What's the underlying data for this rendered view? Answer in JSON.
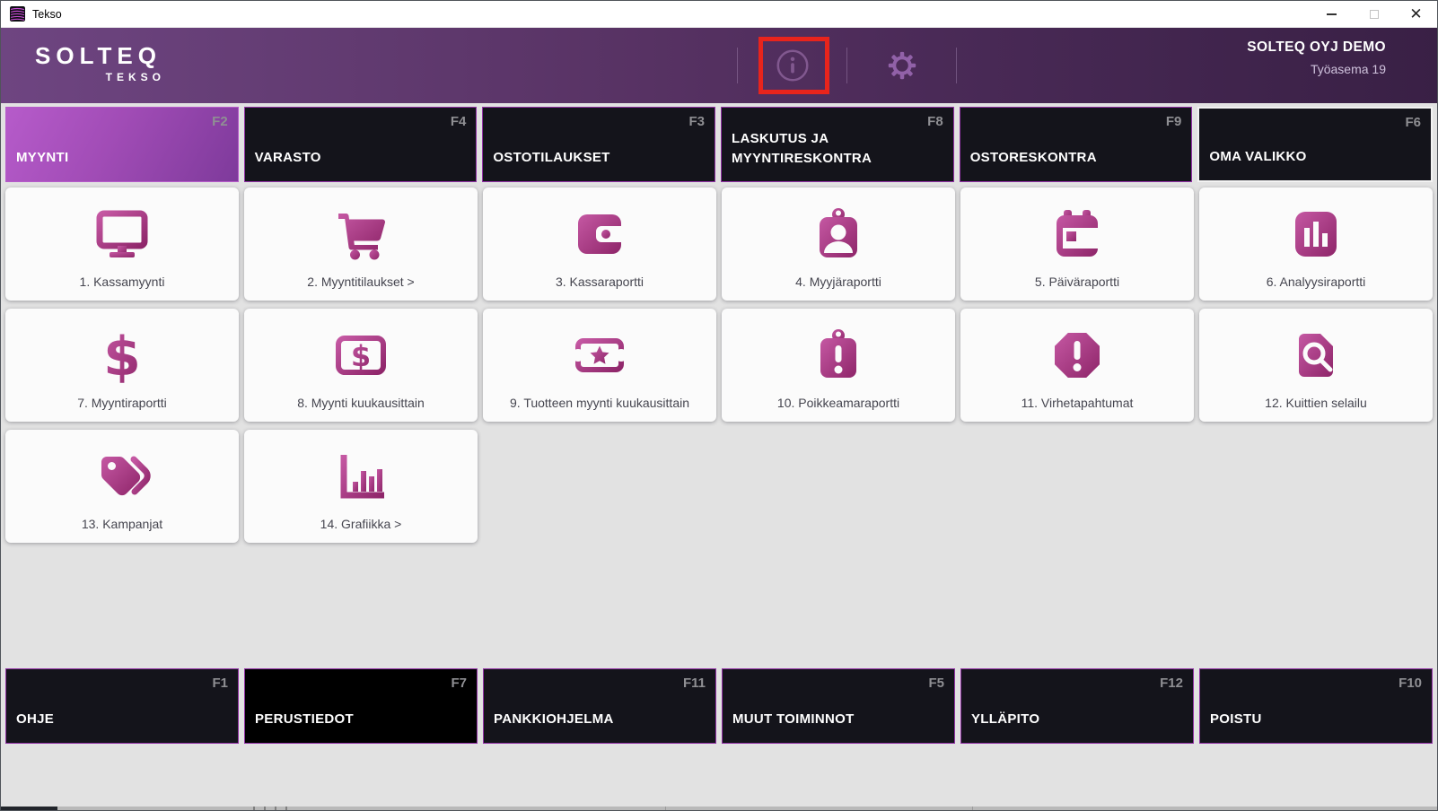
{
  "window": {
    "title": "Tekso"
  },
  "header": {
    "logo_primary": "SOLTEQ",
    "logo_secondary": "TEKSO",
    "company": "SOLTEQ OYJ DEMO",
    "workstation": "Työasema 19",
    "icons": [
      "info-icon",
      "gear-icon"
    ]
  },
  "annotation": {
    "target": "info-button",
    "color": "#e8241c"
  },
  "top_tabs": [
    {
      "label": "MYYNTI",
      "fkey": "F2",
      "active": true
    },
    {
      "label": "VARASTO",
      "fkey": "F4"
    },
    {
      "label": "OSTOTILAUKSET",
      "fkey": "F3"
    },
    {
      "label": "LASKUTUS JA MYYNTIRESKONTRA",
      "fkey": "F8"
    },
    {
      "label": "OSTORESKONTRA",
      "fkey": "F9"
    },
    {
      "label": "OMA VALIKKO",
      "fkey": "F6"
    }
  ],
  "tiles": [
    {
      "label": "1. Kassamyynti",
      "icon": "desktop-icon"
    },
    {
      "label": "2. Myyntitilaukset >",
      "icon": "shopping-cart-icon"
    },
    {
      "label": "3. Kassaraportti",
      "icon": "wallet-icon"
    },
    {
      "label": "4. Myyjäraportti",
      "icon": "id-badge-icon"
    },
    {
      "label": "5. Päiväraportti",
      "icon": "calendar-icon"
    },
    {
      "label": "6. Analyysiraportti",
      "icon": "bar-chart-square-icon"
    },
    {
      "label": "7. Myyntiraportti",
      "icon": "dollar-sign-icon"
    },
    {
      "label": "8. Myynti kuukausittain",
      "icon": "money-bill-icon"
    },
    {
      "label": "9. Tuotteen myynti kuukausittain",
      "icon": "ticket-star-icon"
    },
    {
      "label": "10. Poikkeamaraportti",
      "icon": "clipboard-exclamation-icon"
    },
    {
      "label": "11. Virhetapahtumat",
      "icon": "octagon-exclamation-icon"
    },
    {
      "label": "12. Kuittien selailu",
      "icon": "file-search-icon"
    },
    {
      "label": "13. Kampanjat",
      "icon": "tags-icon"
    },
    {
      "label": "14. Grafiikka >",
      "icon": "bar-chart-axis-icon"
    }
  ],
  "bottom_tabs": [
    {
      "label": "OHJE",
      "fkey": "F1"
    },
    {
      "label": "PERUSTIEDOT",
      "fkey": "F7"
    },
    {
      "label": "PANKKIOHJELMA",
      "fkey": "F11"
    },
    {
      "label": "MUUT TOIMINNOT",
      "fkey": "F5"
    },
    {
      "label": "YLLÄPITO",
      "fkey": "F12"
    },
    {
      "label": "POISTU",
      "fkey": "F10"
    }
  ],
  "colors": {
    "header_gradient_start": "#6e4581",
    "header_gradient_end": "#392045",
    "tab_background": "#14141b",
    "tab_border_accent": "#9232a6",
    "active_tab_start": "#b65bca",
    "active_tab_end": "#7e3a9b",
    "icon_gradient_start": "#c558a3",
    "icon_gradient_end": "#8e2569",
    "annotation_red": "#e8241c"
  }
}
